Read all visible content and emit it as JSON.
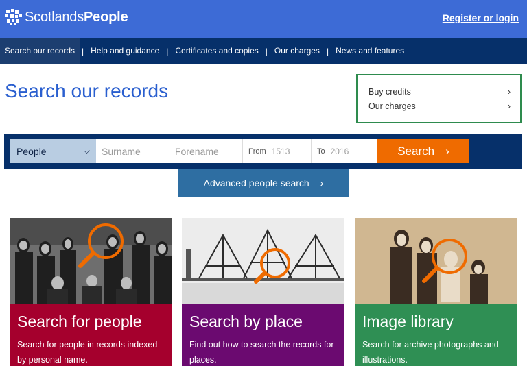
{
  "header": {
    "logo_text_light": "Scotlands",
    "logo_text_bold": "People",
    "login_label": "Register or login"
  },
  "nav": {
    "items": [
      {
        "label": "Search our records"
      },
      {
        "label": "Help and guidance"
      },
      {
        "label": "Certificates and copies"
      },
      {
        "label": "Our charges"
      },
      {
        "label": "News and features"
      }
    ],
    "separator": "|"
  },
  "page": {
    "title": "Search our records"
  },
  "credits_box": {
    "links": [
      {
        "label": "Buy credits"
      },
      {
        "label": "Our charges"
      }
    ]
  },
  "search": {
    "type_selected": "People",
    "surname_placeholder": "Surname",
    "forename_placeholder": "Forename",
    "from_label": "From",
    "from_placeholder": "1513",
    "to_label": "To",
    "to_placeholder": "2016",
    "submit_label": "Search"
  },
  "advanced": {
    "label": "Advanced people search"
  },
  "cards": [
    {
      "title": "Search for people",
      "desc": "Search for people in records indexed by personal name.",
      "color": "#a5002d"
    },
    {
      "title": "Search by place",
      "desc": "Find out how to search the records for places.",
      "color": "#6b0a70"
    },
    {
      "title": "Image library",
      "desc": "Search for archive photographs and illustrations.",
      "color": "#2f8f54"
    }
  ],
  "icons": {
    "chevron": "›",
    "dropdown": "⌄"
  },
  "colors": {
    "header_blue": "#3d6bd6",
    "nav_navy": "#06306a",
    "search_orange": "#ef6b00",
    "advanced_blue": "#2e6ea2"
  }
}
